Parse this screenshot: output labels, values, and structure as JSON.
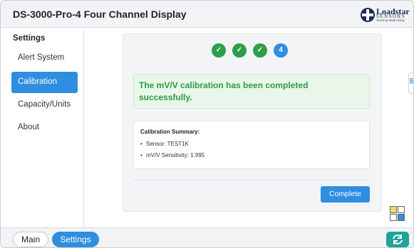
{
  "app": {
    "title": "DS-3000-Pro-4 Four Channel Display",
    "logo_name": "Loadstar",
    "logo_sub": "SENSORS",
    "logo_tag": "Sensing Made Easy"
  },
  "sidebar": {
    "heading": "Settings",
    "items": [
      {
        "label": "Alert System",
        "active": false
      },
      {
        "label": "Calibration",
        "active": true
      },
      {
        "label": "Capacity/Units",
        "active": false
      },
      {
        "label": "About",
        "active": false
      }
    ]
  },
  "wizard": {
    "steps": [
      {
        "label": "✓",
        "state": "done"
      },
      {
        "label": "✓",
        "state": "done"
      },
      {
        "label": "✓",
        "state": "done"
      },
      {
        "label": "4",
        "state": "current"
      }
    ],
    "success_message": "The mV/V calibration has been completed successfully.",
    "summary": {
      "title": "Calibration Summary:",
      "items": [
        "Sensor: TEST1K",
        "mV/V Sensitivity: 1.995"
      ]
    },
    "complete_label": "Complete"
  },
  "side_tab": {
    "icon": "expand-icon",
    "glyph": "⊟"
  },
  "grid_widget": {
    "icon": "layout-grid-icon",
    "cell_colors": [
      "#f5d76e",
      "#ffffff",
      "#ffffff",
      "#2f8ee0"
    ]
  },
  "footer": {
    "main_label": "Main",
    "settings_label": "Settings",
    "refresh_icon": "refresh-icon"
  },
  "colors": {
    "accent": "#2f8ee0",
    "success": "#2e9e4b",
    "success_text": "#2d9a3f",
    "refresh": "#1fa39a"
  }
}
